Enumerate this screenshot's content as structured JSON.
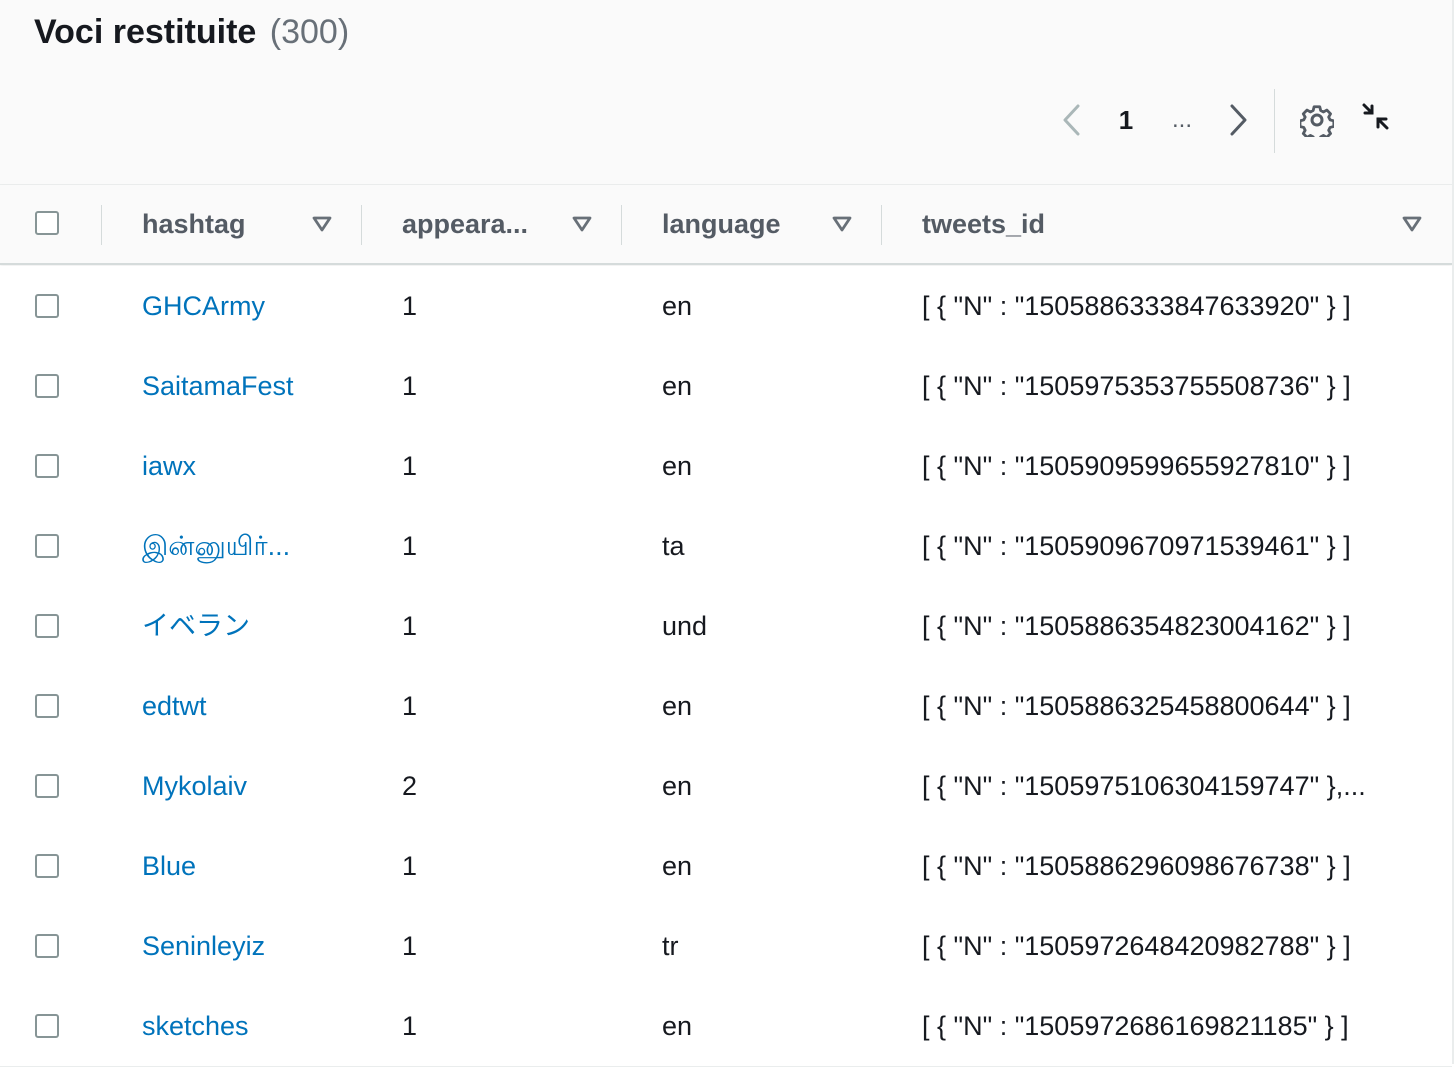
{
  "header": {
    "title": "Voci restituite",
    "count": "(300)"
  },
  "pagination": {
    "current_page": "1",
    "ellipsis": "...",
    "prev_icon": "chevron-left-icon",
    "next_icon": "chevron-right-icon"
  },
  "toolbar": {
    "settings_icon": "gear-icon",
    "collapse_icon": "collapse-icon"
  },
  "table": {
    "columns": [
      "hashtag",
      "appeara...",
      "language",
      "tweets_id"
    ],
    "rows": [
      {
        "hashtag": "GHCArmy",
        "appearances": "1",
        "language": "en",
        "tweets_id": "[ { \"N\" : \"1505886333847633920\" } ]"
      },
      {
        "hashtag": "SaitamaFest",
        "appearances": "1",
        "language": "en",
        "tweets_id": "[ { \"N\" : \"1505975353755508736\" } ]"
      },
      {
        "hashtag": "iawx",
        "appearances": "1",
        "language": "en",
        "tweets_id": "[ { \"N\" : \"1505909599655927810\" } ]"
      },
      {
        "hashtag": "இன்னுயிர்...",
        "appearances": "1",
        "language": "ta",
        "tweets_id": "[ { \"N\" : \"1505909670971539461\" } ]"
      },
      {
        "hashtag": "イベラン",
        "appearances": "1",
        "language": "und",
        "tweets_id": "[ { \"N\" : \"1505886354823004162\" } ]"
      },
      {
        "hashtag": "edtwt",
        "appearances": "1",
        "language": "en",
        "tweets_id": "[ { \"N\" : \"1505886325458800644\" } ]"
      },
      {
        "hashtag": "Mykolaiv",
        "appearances": "2",
        "language": "en",
        "tweets_id": "[ { \"N\" : \"1505975106304159747\" },..."
      },
      {
        "hashtag": "Blue",
        "appearances": "1",
        "language": "en",
        "tweets_id": "[ { \"N\" : \"1505886296098676738\" } ]"
      },
      {
        "hashtag": "Seninleyiz",
        "appearances": "1",
        "language": "tr",
        "tweets_id": "[ { \"N\" : \"1505972648420982788\" } ]"
      },
      {
        "hashtag": "sketches",
        "appearances": "1",
        "language": "en",
        "tweets_id": "[ { \"N\" : \"1505972686169821185\" } ]"
      }
    ]
  },
  "colors": {
    "link": "#0073bb",
    "header_bg": "#fafafa",
    "text": "#16191f",
    "muted": "#687078"
  }
}
